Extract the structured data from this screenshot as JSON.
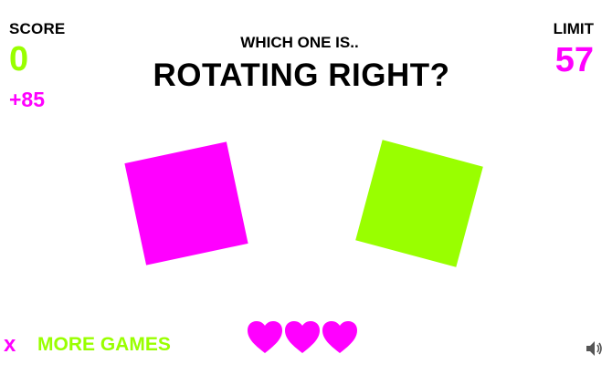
{
  "hud": {
    "score_label": "SCORE",
    "score_value": "0",
    "score_bonus": "+85",
    "limit_label": "LIMIT",
    "limit_value": "57"
  },
  "prompt": {
    "line1": "WHICH ONE IS..",
    "line2": "ROTATING RIGHT?"
  },
  "choices": [
    {
      "color": "#ff00ff",
      "name": "magenta-square"
    },
    {
      "color": "#99ff00",
      "name": "lime-square"
    }
  ],
  "footer": {
    "close_glyph": "x",
    "more_games_label": "MORE GAMES",
    "lives": 3,
    "heart_color": "#ff00ff",
    "sound_icon": "speaker-icon"
  },
  "colors": {
    "accent_green": "#99ff00",
    "accent_magenta": "#ff00ff",
    "text": "#000000",
    "background": "#ffffff"
  }
}
